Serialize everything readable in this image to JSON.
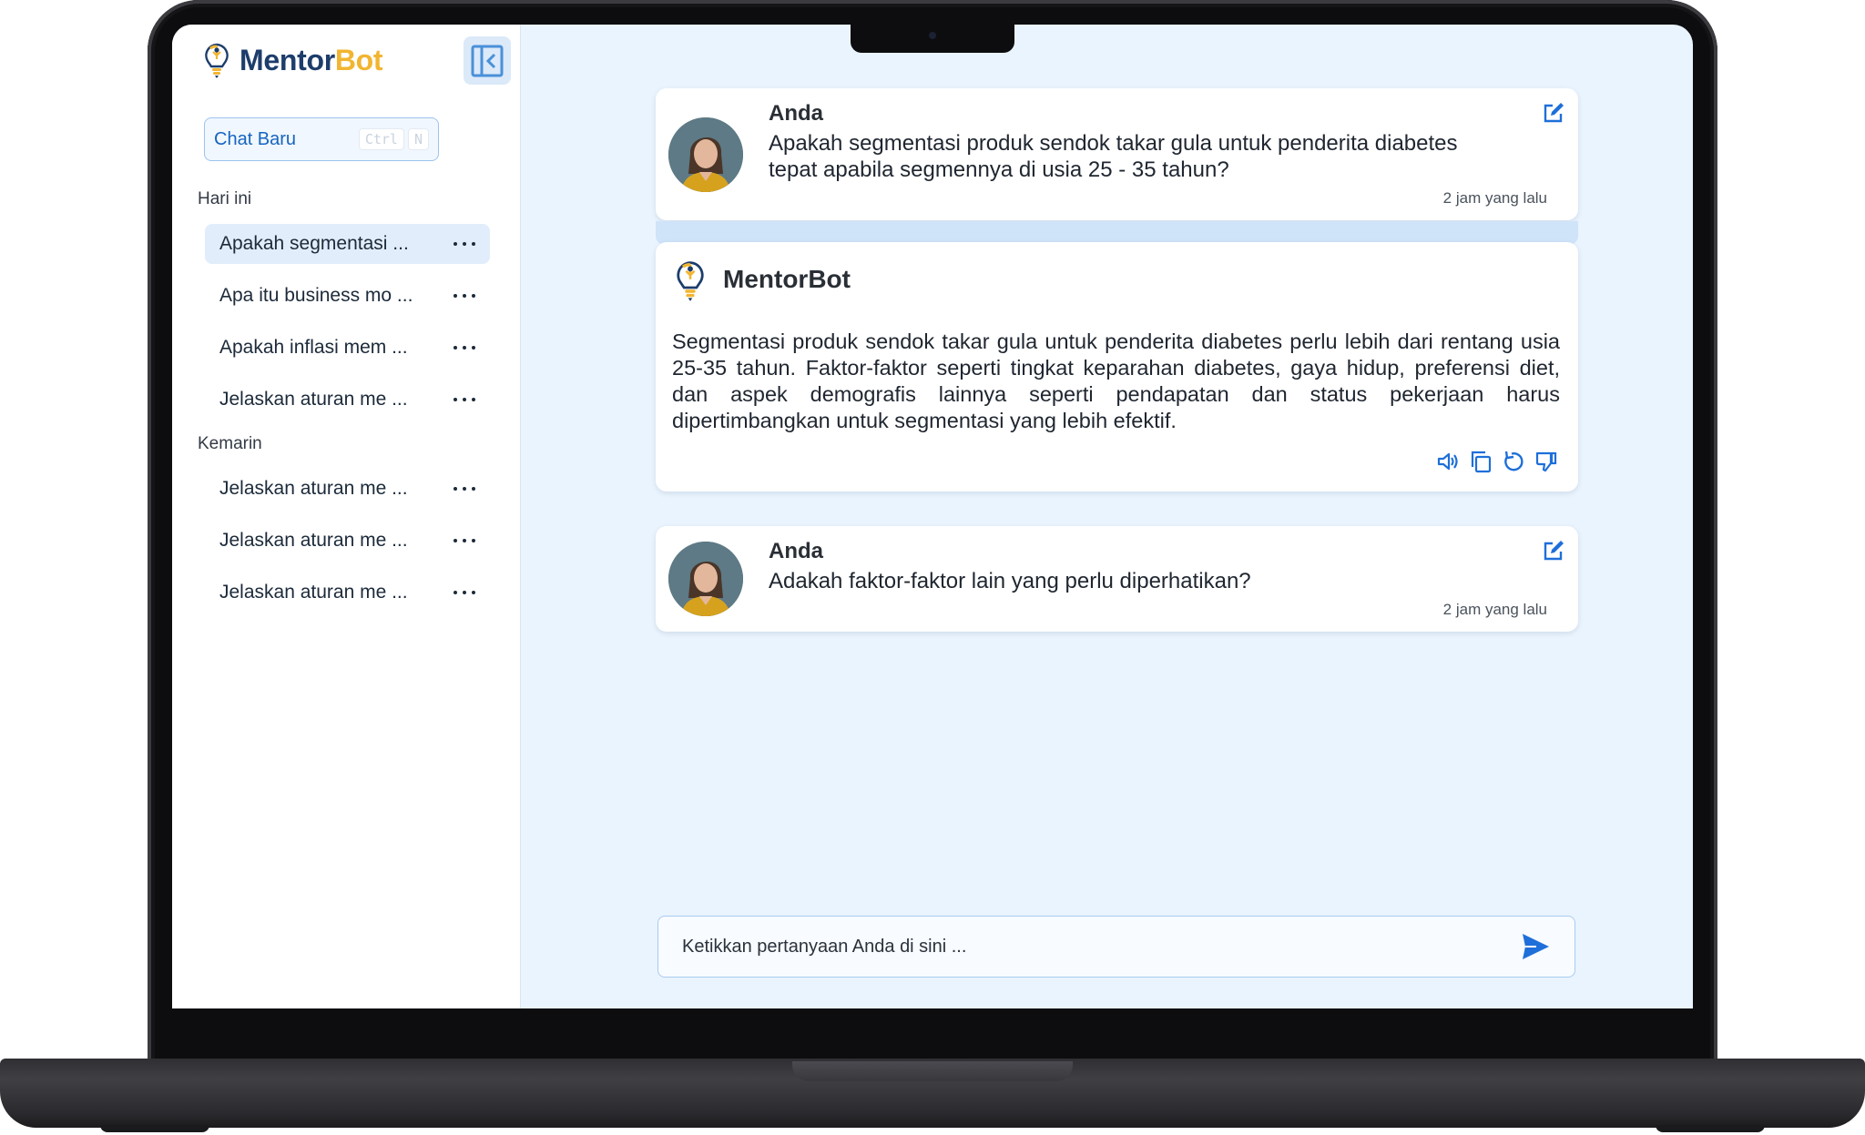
{
  "app": {
    "brand_part1": "Mentor",
    "brand_part2": "Bot",
    "accent_color": "#1565c0",
    "brand_dark": "#1d3d6b",
    "brand_yellow": "#f2b531"
  },
  "sidebar": {
    "new_chat_label": "Chat Baru",
    "new_chat_shortcut": [
      "Ctrl",
      "N"
    ],
    "sections": [
      {
        "label": "Hari ini",
        "items": [
          {
            "label": "Apakah segmentasi ...",
            "active": true
          },
          {
            "label": "Apa itu business mo ..."
          },
          {
            "label": "Apakah inflasi mem ..."
          },
          {
            "label": "Jelaskan aturan me ..."
          }
        ]
      },
      {
        "label": "Kemarin",
        "items": [
          {
            "label": "Jelaskan aturan me ..."
          },
          {
            "label": "Jelaskan aturan me ..."
          },
          {
            "label": "Jelaskan aturan me ..."
          }
        ]
      }
    ]
  },
  "chat": {
    "messages": [
      {
        "sender": "Anda",
        "text_line1": "Apakah segmentasi produk sendok takar gula untuk penderita diabetes",
        "text_line2": "tepat apabila segmennya di usia 25 - 35 tahun?",
        "time": "2 jam yang lalu"
      },
      {
        "sender": "MentorBot",
        "text": "Segmentasi produk sendok takar gula untuk penderita diabetes perlu lebih dari rentang usia 25-35 tahun. Faktor-faktor seperti tingkat keparahan diabetes, gaya hidup, preferensi diet, dan aspek demografis lainnya seperti pendapatan dan status pekerjaan harus dipertimbangkan untuk segmentasi yang lebih efektif.",
        "actions": [
          "speaker-icon",
          "copy-icon",
          "regenerate-icon",
          "thumbs-down-icon"
        ]
      },
      {
        "sender": "Anda",
        "text_line1": "Adakah faktor-faktor lain yang perlu diperhatikan?",
        "time": "2 jam yang lalu"
      }
    ]
  },
  "composer": {
    "placeholder": "Ketikkan pertanyaan Anda di sini ..."
  }
}
